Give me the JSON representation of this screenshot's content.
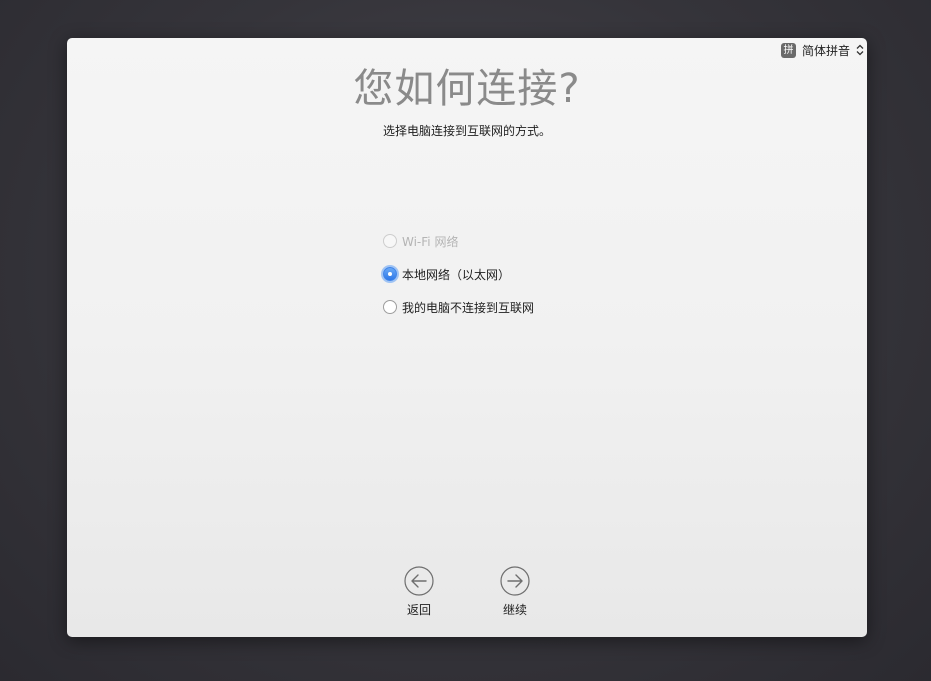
{
  "input_method": {
    "icon_char": "拼",
    "label": "简体拼音"
  },
  "title": "您如何连接?",
  "subtitle": "选择电脑连接到互联网的方式。",
  "options": [
    {
      "label": "Wi-Fi 网络",
      "enabled": false,
      "selected": false
    },
    {
      "label": "本地网络（以太网）",
      "enabled": true,
      "selected": true
    },
    {
      "label": "我的电脑不连接到互联网",
      "enabled": true,
      "selected": false
    }
  ],
  "buttons": {
    "back_label": "返回",
    "continue_label": "继续"
  },
  "colors": {
    "accent": "#3f84ea",
    "background": "#35343a"
  }
}
